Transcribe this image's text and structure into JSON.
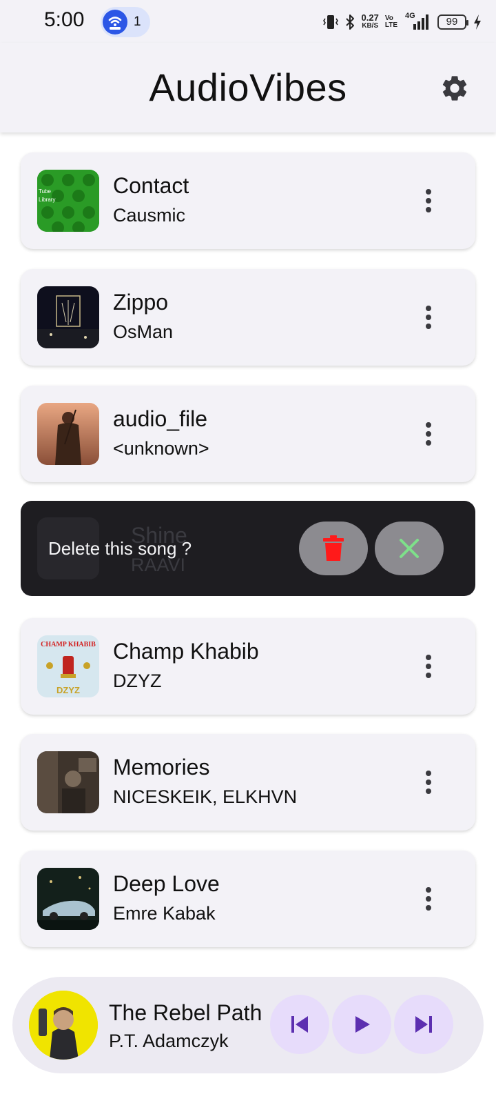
{
  "status_bar": {
    "time": "5:00",
    "hotspot_count": "1",
    "net_speed_value": "0.27",
    "net_speed_unit": "KB/S",
    "volte_line1": "Vo",
    "volte_line2": "LTE",
    "network_type": "4G",
    "battery_level": "99",
    "icons": [
      "vibrate-icon",
      "bluetooth-icon",
      "signal-icon",
      "charging-icon"
    ]
  },
  "app_bar": {
    "title": "AudioVibes",
    "settings_icon": "gear-icon"
  },
  "songs": [
    {
      "title": "Contact",
      "artist": "Causmic",
      "cover_lines": [
        "Tube",
        "Library"
      ]
    },
    {
      "title": "Zippo",
      "artist": "OsMan"
    },
    {
      "title": "audio_file",
      "artist": "<unknown>"
    },
    {
      "title": "Shine",
      "artist": "RAAVI"
    },
    {
      "title": "Champ Khabib",
      "artist": "DZYZ",
      "cover_lines": [
        "CHAMP KHABIB",
        "DZYZ"
      ]
    },
    {
      "title": "Memories",
      "artist": "NICESKEIK, ELKHVN"
    },
    {
      "title": "Deep Love",
      "artist": "Emre Kabak"
    }
  ],
  "delete_snackbar": {
    "message": "Delete this song ?",
    "confirm_icon": "trash-icon",
    "cancel_icon": "close-icon"
  },
  "player": {
    "title": "The Rebel Path",
    "artist": "P.T. Adamczyk",
    "controls": [
      "skip-previous-icon",
      "play-icon",
      "skip-next-icon"
    ]
  },
  "colors": {
    "accent": "#e7dcfb",
    "surface": "#f3f2f7",
    "snackbar": "#1e1d21",
    "delete_red": "#ff1a1a",
    "cancel_green": "#7ee08a"
  }
}
